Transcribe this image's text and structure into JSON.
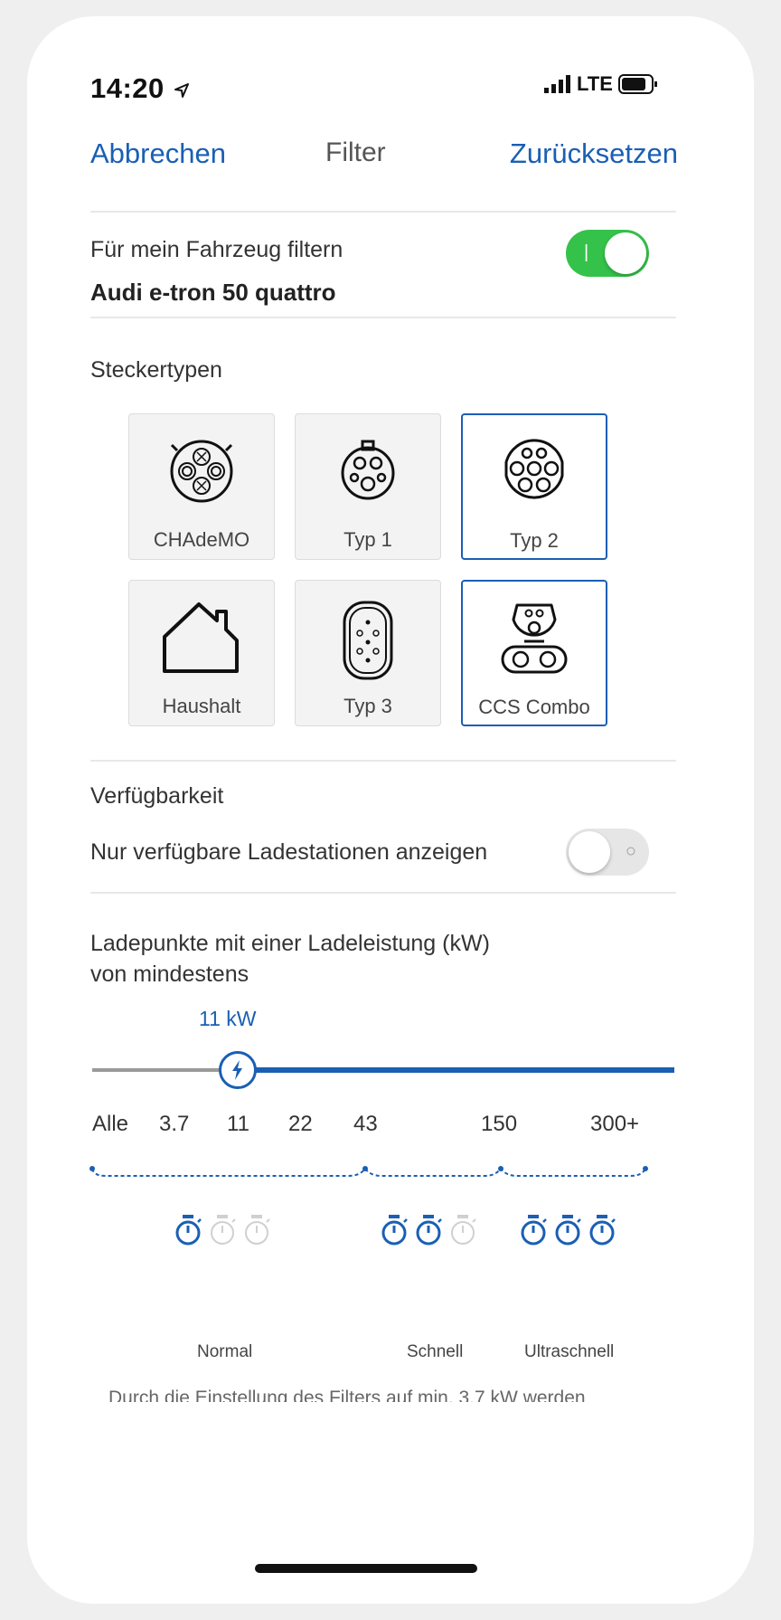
{
  "status": {
    "time": "14:20",
    "network": "LTE"
  },
  "nav": {
    "cancel": "Abbrechen",
    "title": "Filter",
    "reset": "Zurücksetzen"
  },
  "vehicle": {
    "label": "Für mein Fahrzeug filtern",
    "name": "Audi e-tron 50 quattro",
    "toggle_on": true
  },
  "plugs": {
    "title": "Steckertypen",
    "items": [
      {
        "label": "CHAdeMO",
        "icon": "chademo-icon",
        "selected": false
      },
      {
        "label": "Typ 1",
        "icon": "type1-icon",
        "selected": false
      },
      {
        "label": "Typ 2",
        "icon": "type2-icon",
        "selected": true
      },
      {
        "label": "Haushalt",
        "icon": "house-icon",
        "selected": false
      },
      {
        "label": "Typ 3",
        "icon": "type3-icon",
        "selected": false
      },
      {
        "label": "CCS Combo",
        "icon": "ccs-combo-icon",
        "selected": true
      }
    ]
  },
  "availability": {
    "title": "Verfügbarkeit",
    "label": "Nur verfügbare Ladestationen anzeigen",
    "toggle_on": false
  },
  "power": {
    "title_line1": "Ladepunkte mit einer Ladeleistung (kW)",
    "title_line2": "von mindestens",
    "value_label": "11 kW",
    "scale": [
      "Alle",
      "3.7",
      "11",
      "22",
      "43",
      "150",
      "300+"
    ],
    "categories": [
      "Normal",
      "Schnell",
      "Ultraschnell"
    ],
    "footnote": "Durch die Einstellung des Filters auf min. 3,7 kW werden"
  },
  "colors": {
    "accent": "#1a5fb4",
    "toggle_on": "#35c24a"
  }
}
